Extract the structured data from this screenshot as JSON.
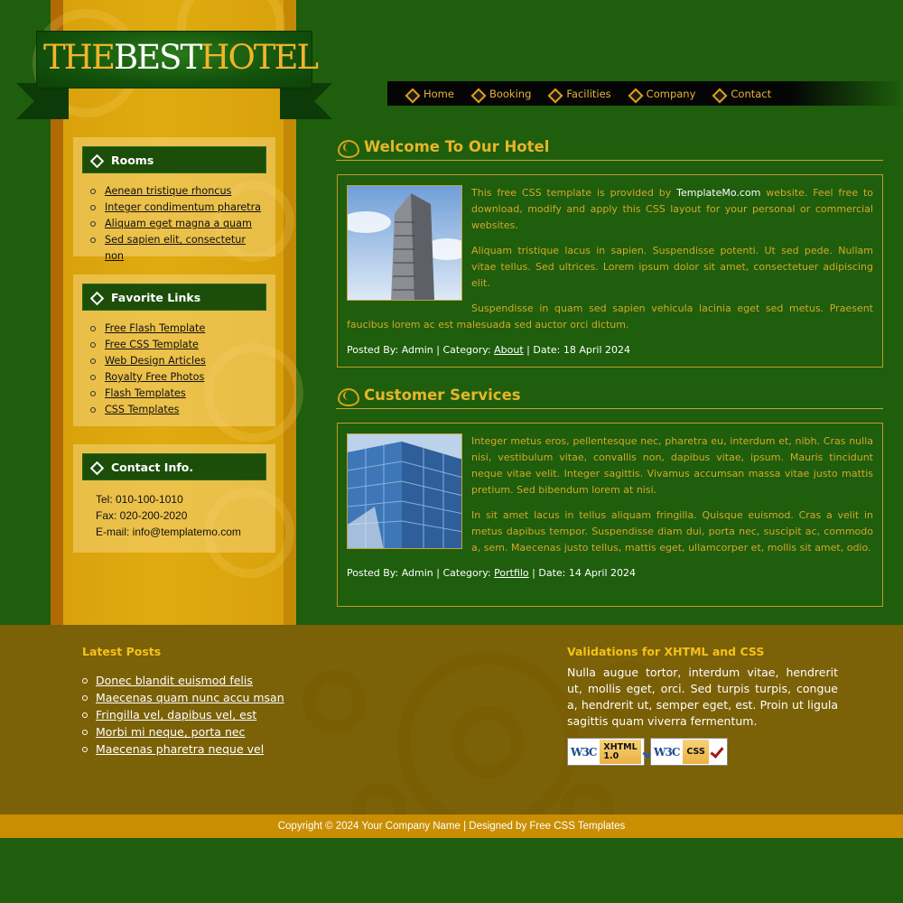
{
  "logo": {
    "part1": "THE",
    "part2": "BEST",
    "part3": "HOTEL"
  },
  "nav": [
    "Home",
    "Booking",
    "Facilities",
    "Company",
    "Contact"
  ],
  "sidebar": {
    "rooms": {
      "title": "Rooms",
      "items": [
        "Aenean tristique rhoncus",
        "Integer condimentum pharetra",
        "Aliquam eget magna a quam",
        "Sed sapien elit, consectetur non"
      ]
    },
    "favorite_links": {
      "title": "Favorite Links",
      "items": [
        "Free Flash Template",
        "Free CSS Template",
        "Web Design Articles",
        "Royalty Free Photos",
        "Flash Templates",
        "CSS Templates"
      ]
    },
    "contact": {
      "title": "Contact Info.",
      "tel": "Tel: 010-100-1010",
      "fax": "Fax: 020-200-2020",
      "email": "E-mail: info@templatemo.com"
    }
  },
  "sections": [
    {
      "title": "Welcome To Our Hotel",
      "p1_pre": "This free CSS template is provided by ",
      "p1_link": "TemplateMo.com",
      "p1_post": " website. Feel free to download, modify and apply this CSS layout for your personal or commercial websites.",
      "p2": "Aliquam tristique lacus in sapien. Suspendisse potenti. Ut sed pede. Nullam vitae tellus. Sed ultrices. Lorem ipsum dolor sit amet, consectetuer adipiscing elit.",
      "p3": "Suspendisse in quam sed sapien vehicula lacinia eget sed metus. Praesent faucibus lorem ac est malesuada sed auctor orci dictum.",
      "meta_pre": "Posted By: Admin | Category: ",
      "meta_cat": "About",
      "meta_post": " | Date: 18 April 2024"
    },
    {
      "title": "Customer Services",
      "p1": "Integer metus eros, pellentesque nec, pharetra eu, interdum et, nibh. Cras nulla nisi, vestibulum vitae, convallis non, dapibus vitae, ipsum. Mauris tincidunt neque vitae velit. Integer sagittis. Vivamus accumsan massa vitae justo mattis pretium. Sed bibendum lorem at nisi.",
      "p2": "In sit amet lacus in tellus aliquam fringilla. Quisque euismod. Cras a velit in metus dapibus tempor. Suspendisse diam dui, porta nec, suscipit ac, commodo a, sem. Maecenas justo tellus, mattis eget, ullamcorper et, mollis sit amet, odio.",
      "meta_pre": "Posted By: Admin | Category: ",
      "meta_cat": "Portfilo",
      "meta_post": " | Date: 14 April 2024"
    }
  ],
  "footer": {
    "latest_title": "Latest Posts",
    "latest": [
      "Donec blandit euismod felis",
      "Maecenas quam nunc accu msan",
      "Fringilla vel, dapibus vel, est",
      "Morbi mi neque, porta nec",
      "Maecenas pharetra neque vel"
    ],
    "valid_title": "Validations for XHTML and CSS",
    "valid_text": "Nulla augue tortor, interdum vitae, hendrerit ut, mollis eget, orci. Sed turpis turpis, congue a, hendrerit ut, semper eget, est. Proin ut ligula sagittis quam viverra fermentum.",
    "badge_w3c": "W3C",
    "badge_xhtml": "XHTML",
    "badge_xhtml_ver": "1.0",
    "badge_css": "CSS",
    "copyright": "Copyright © 2024 Your Company Name | Designed by Free CSS Templates"
  }
}
